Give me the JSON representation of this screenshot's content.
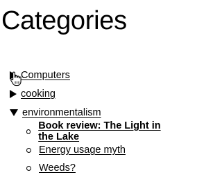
{
  "page": {
    "title": "Categories"
  },
  "categories": [
    {
      "label": "Computers",
      "expanded": false
    },
    {
      "label": "cooking",
      "expanded": false
    },
    {
      "label": "environmentalism",
      "expanded": true
    }
  ],
  "posts": [
    {
      "label": "Book review: The Light in the Lake"
    },
    {
      "label": "Energy usage myth"
    },
    {
      "label": "Weeds?"
    }
  ],
  "icons": {
    "collapsed": "triangle-right-icon",
    "expanded": "triangle-down-icon",
    "bullet": "circle-bullet-icon",
    "cursor": "hand-pointer-icon"
  }
}
